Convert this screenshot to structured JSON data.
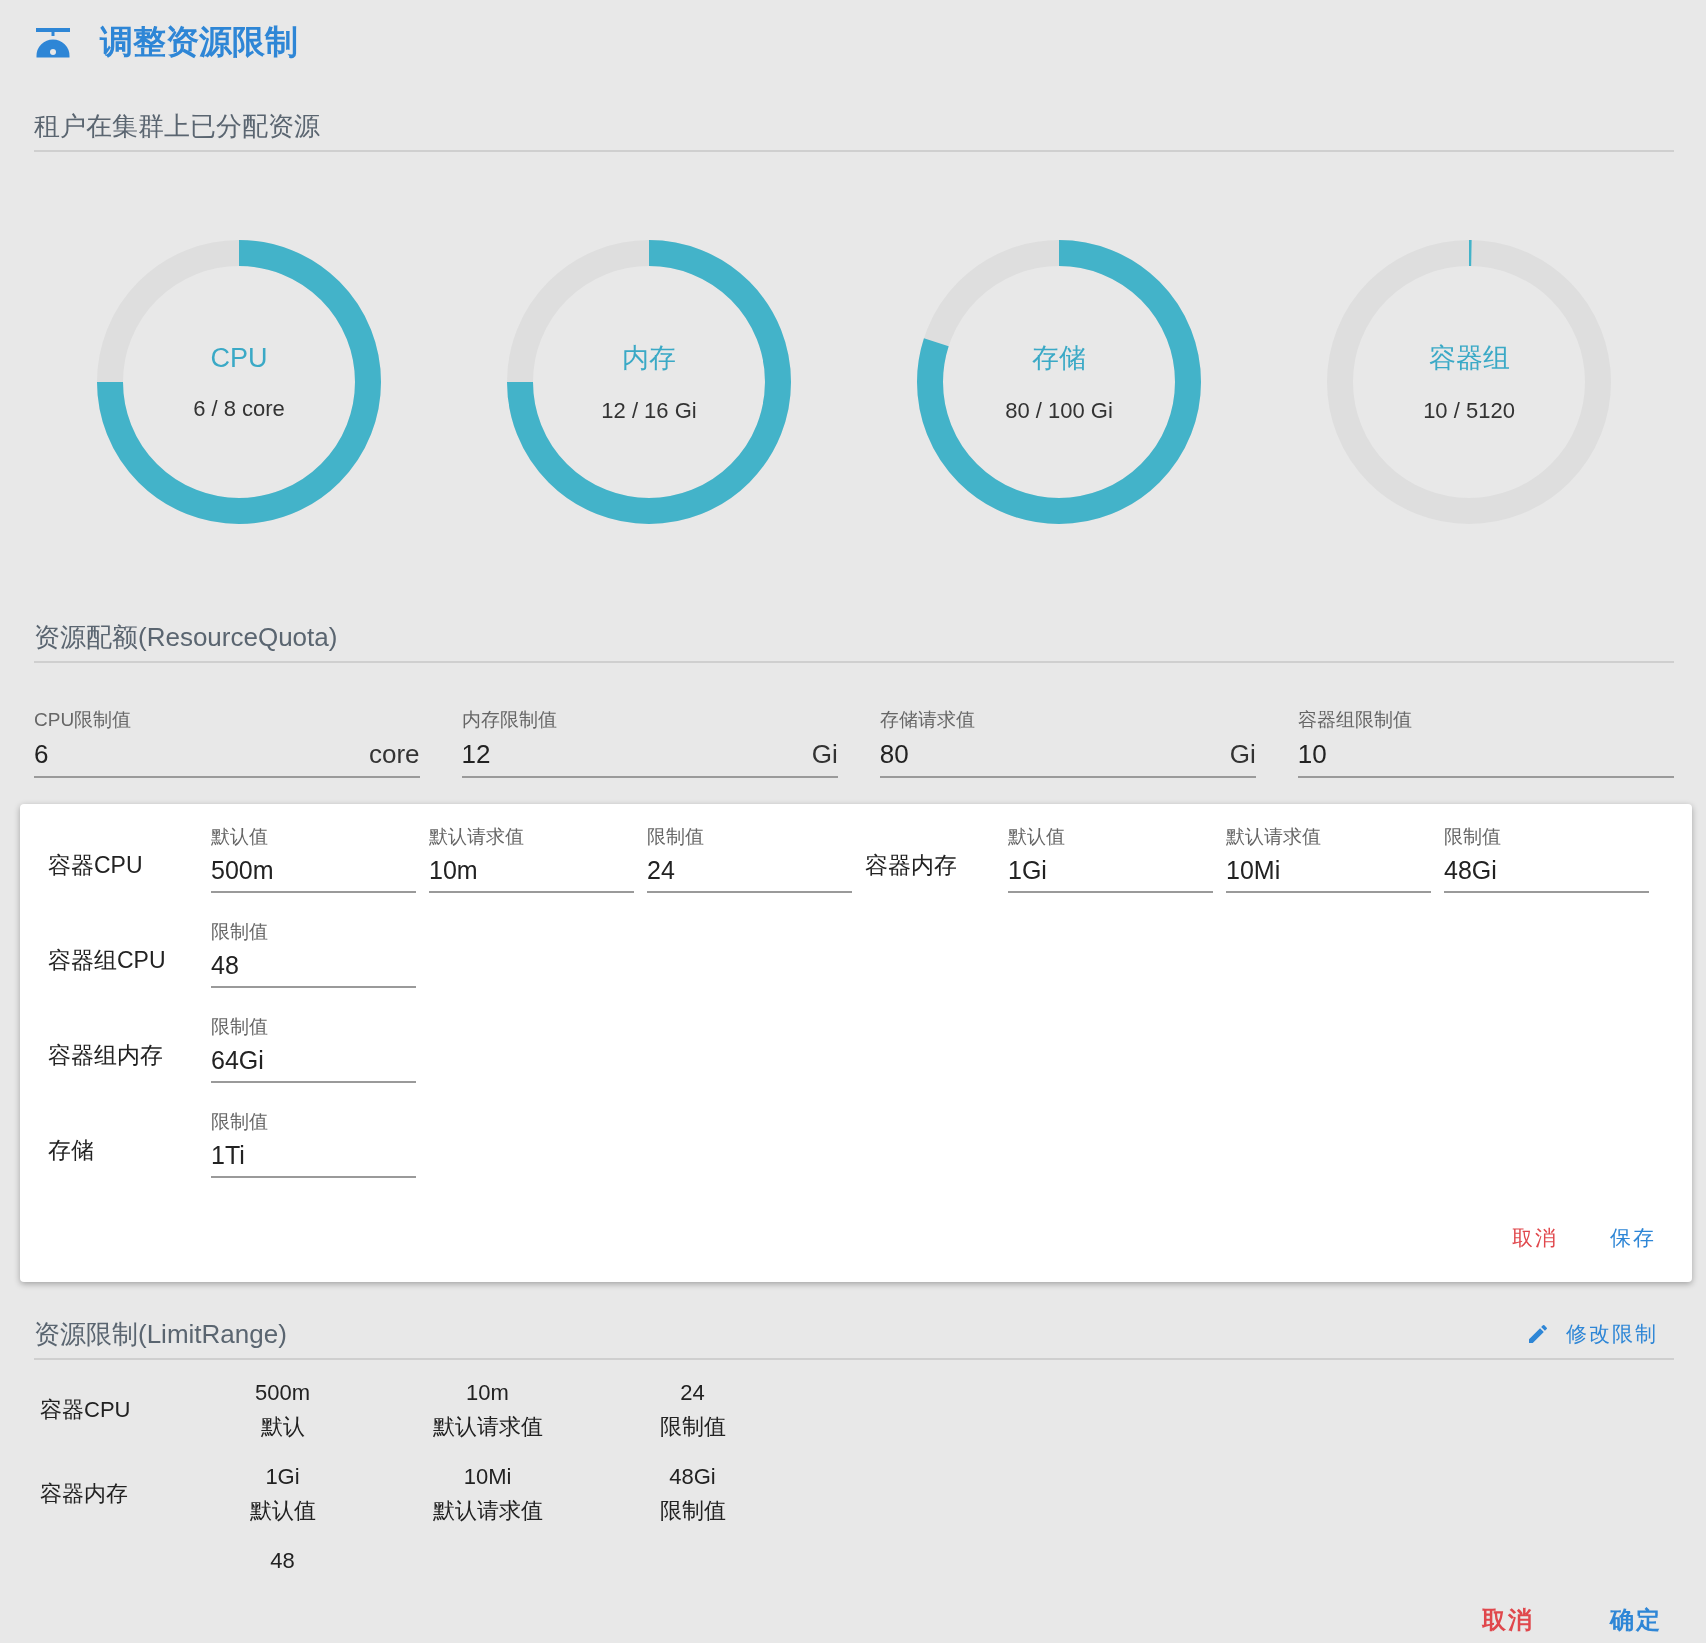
{
  "title": "调整资源限制",
  "allocated": {
    "heading": "租户在集群上已分配资源",
    "gauges": [
      {
        "name": "CPU",
        "reading": "6 / 8 core",
        "level": 0.75
      },
      {
        "name": "内存",
        "reading": "12 / 16 Gi",
        "level": 0.75
      },
      {
        "name": "存储",
        "reading": "80 / 100 Gi",
        "level": 0.8
      },
      {
        "name": "容器组",
        "reading": "10 / 5120",
        "level": 0.002
      }
    ]
  },
  "quota": {
    "heading": "资源配额(ResourceQuota)",
    "fields": [
      {
        "label": "CPU限制值",
        "value": "6",
        "unit": "core"
      },
      {
        "label": "内存限制值",
        "value": "12",
        "unit": "Gi"
      },
      {
        "label": "存储请求值",
        "value": "80",
        "unit": "Gi"
      },
      {
        "label": "容器组限制值",
        "value": "10"
      }
    ]
  },
  "editor": {
    "rows": [
      {
        "groups": [
          {
            "label": "容器CPU",
            "fields": [
              {
                "label": "默认值",
                "value": "500m"
              },
              {
                "label": "默认请求值",
                "value": "10m"
              },
              {
                "label": "限制值",
                "value": "24"
              }
            ]
          },
          {
            "label": "容器内存",
            "fields": [
              {
                "label": "默认值",
                "value": "1Gi"
              },
              {
                "label": "默认请求值",
                "value": "10Mi"
              },
              {
                "label": "限制值",
                "value": "48Gi"
              }
            ]
          }
        ]
      },
      {
        "groups": [
          {
            "label": "容器组CPU",
            "fields": [
              {
                "label": "限制值",
                "value": "48"
              }
            ]
          }
        ]
      },
      {
        "groups": [
          {
            "label": "容器组内存",
            "fields": [
              {
                "label": "限制值",
                "value": "64Gi"
              }
            ]
          }
        ]
      },
      {
        "groups": [
          {
            "label": "存储",
            "fields": [
              {
                "label": "限制值",
                "value": "1Ti"
              }
            ]
          }
        ]
      }
    ],
    "buttons": [
      {
        "label": "取消",
        "kind": "cancel"
      },
      {
        "label": "保存",
        "kind": "primary"
      }
    ]
  },
  "limit_range": {
    "heading": "资源限制(LimitRange)",
    "action": "修改限制",
    "rows": [
      {
        "label": "容器CPU",
        "cells": [
          {
            "value": "500m",
            "caption": "默认"
          },
          {
            "value": "10m",
            "caption": "默认请求值"
          },
          {
            "value": "24",
            "caption": "限制值"
          }
        ]
      },
      {
        "label": "容器内存",
        "cells": [
          {
            "value": "1Gi",
            "caption": "默认值"
          },
          {
            "value": "10Mi",
            "caption": "默认请求值"
          },
          {
            "value": "48Gi",
            "caption": "限制值"
          }
        ]
      },
      {
        "cells": [
          {
            "value": "48"
          }
        ]
      }
    ]
  },
  "footer_buttons": [
    {
      "label": "取消",
      "kind": "cancel"
    },
    {
      "label": "确定",
      "kind": "primary"
    }
  ]
}
